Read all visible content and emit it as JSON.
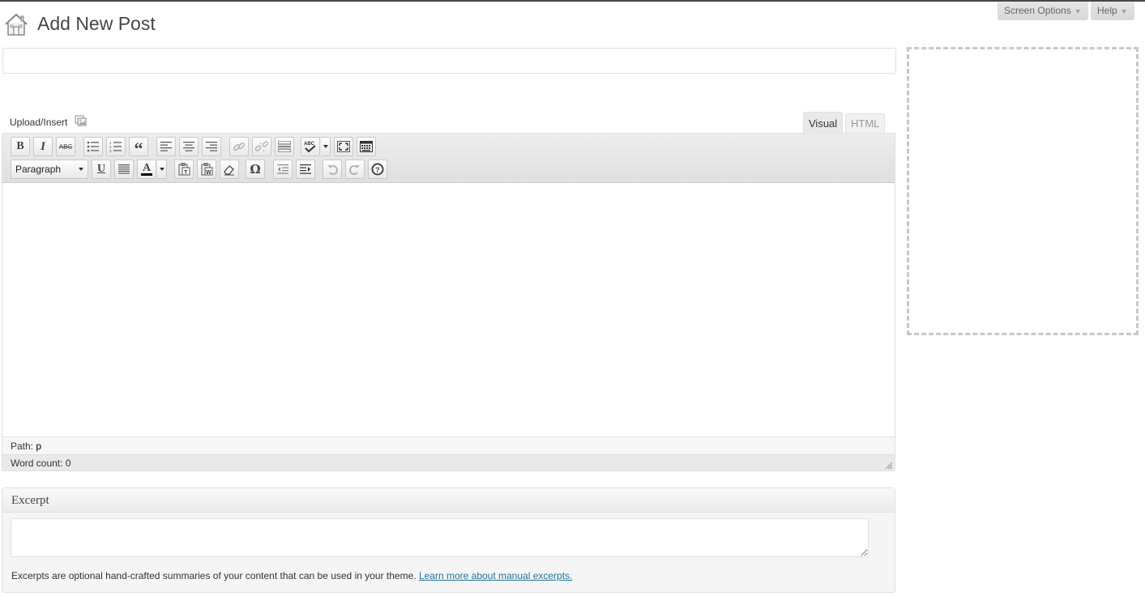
{
  "header": {
    "title": "Add New Post",
    "icon": "home-icon"
  },
  "top_tabs": {
    "screen_options": "Screen Options",
    "help": "Help",
    "arrow": "▼"
  },
  "post": {
    "title_value": "",
    "title_placeholder": ""
  },
  "media": {
    "upload_label": "Upload/Insert"
  },
  "editor_tabs": {
    "visual": "Visual",
    "html": "HTML",
    "active": "Visual"
  },
  "toolbar": {
    "row1": [
      "bold",
      "italic",
      "strikethrough",
      "bullet-list",
      "numbered-list",
      "blockquote",
      "align-left",
      "align-center",
      "align-right",
      "insert-link",
      "unlink",
      "insert-more",
      "spellcheck",
      "fullscreen",
      "kitchen-sink"
    ],
    "row2": [
      "format-select",
      "underline",
      "justify",
      "text-color",
      "paste-text",
      "paste-word",
      "remove-format",
      "special-char",
      "outdent",
      "indent",
      "undo",
      "redo",
      "help"
    ],
    "format_value": "Paragraph",
    "bold_glyph": "B",
    "italic_glyph": "I",
    "strike_glyph": "ABC",
    "underline_glyph": "U",
    "color_glyph": "A",
    "omega_glyph": "Ω",
    "quote_glyph": "“"
  },
  "status": {
    "path_label": "Path:",
    "path_value": "p",
    "word_count_label": "Word count:",
    "word_count_value": "0"
  },
  "excerpt": {
    "heading": "Excerpt",
    "value": "",
    "help_text": "Excerpts are optional hand-crafted summaries of your content that can be used in your theme.",
    "help_link": "Learn more about manual excerpts."
  },
  "colors": {
    "link": "#21759b",
    "toolbar_bg": "#e9e9e9",
    "border": "#dfdfdf"
  }
}
